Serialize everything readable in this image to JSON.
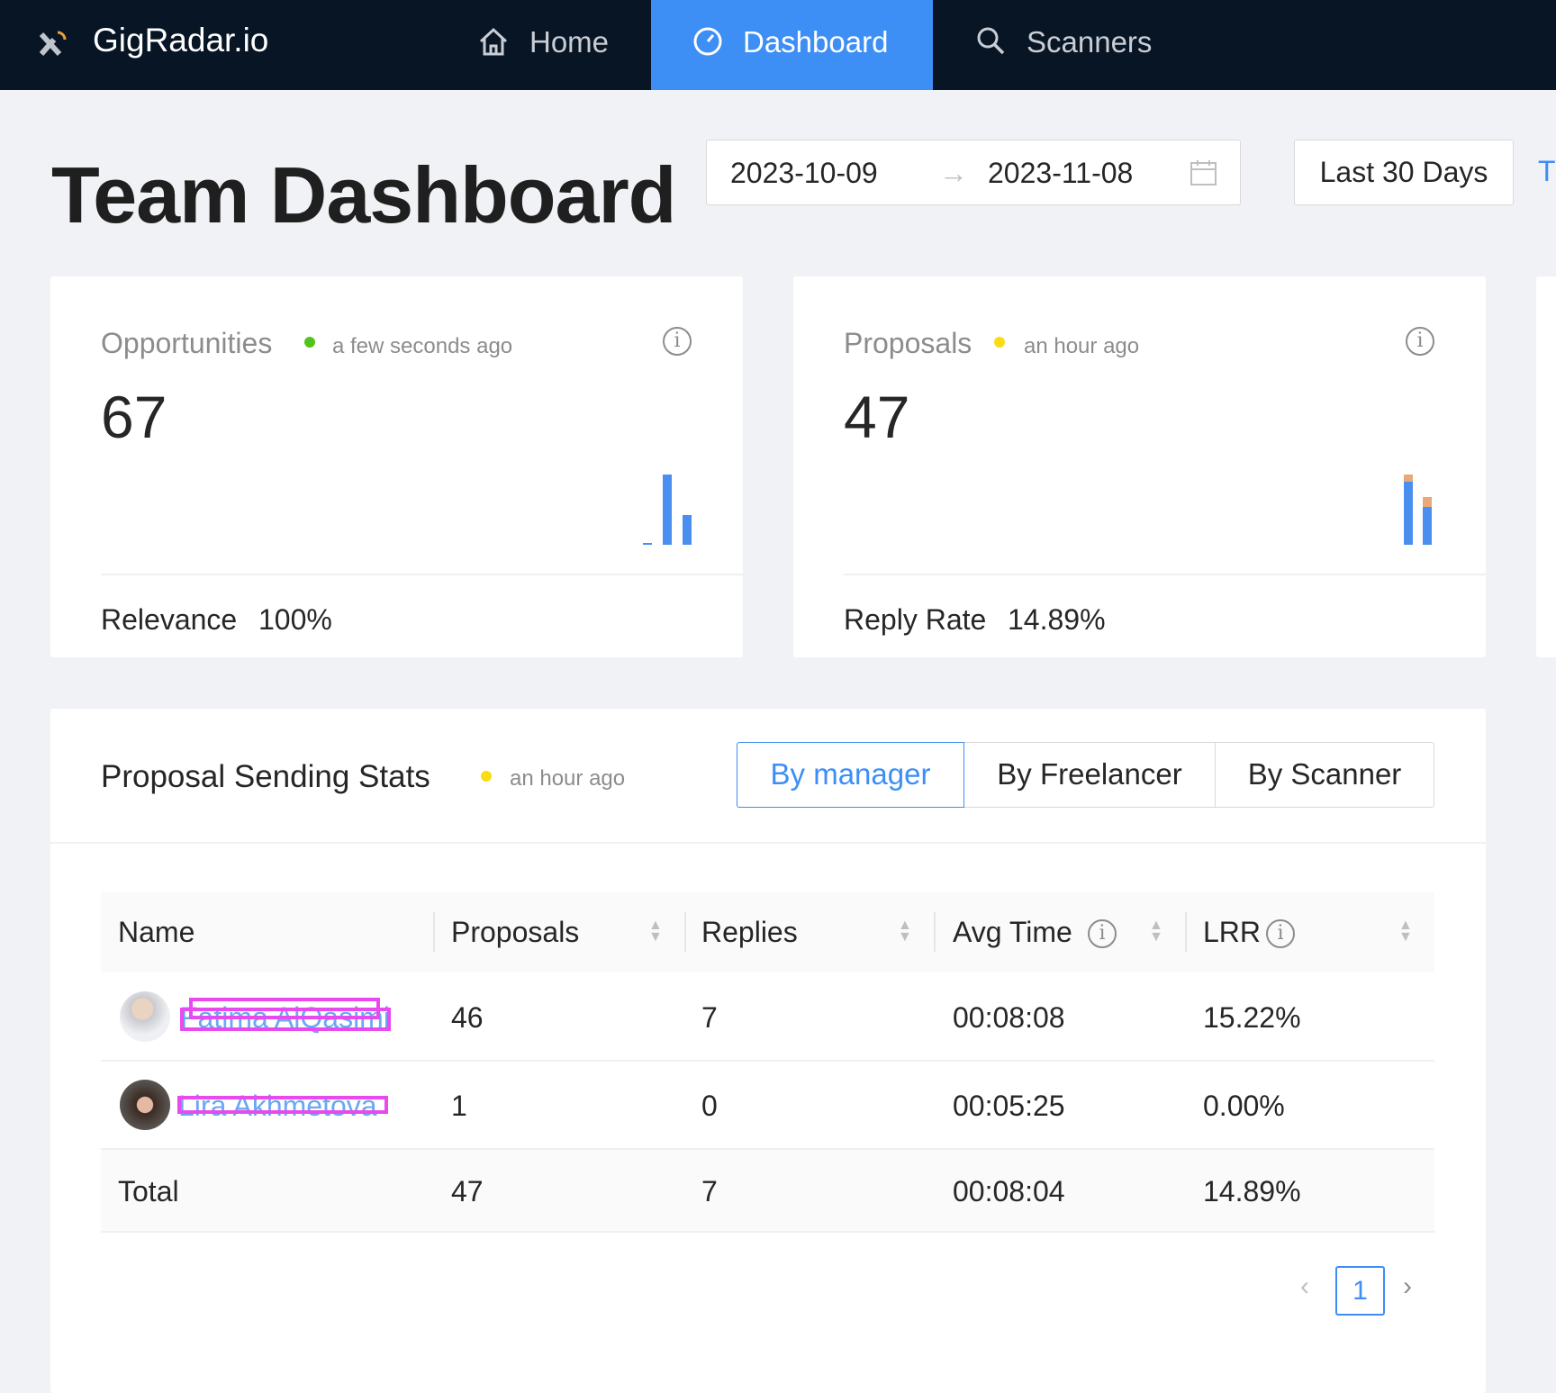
{
  "nav": {
    "brand": "GigRadar.io",
    "items": [
      {
        "label": "Home",
        "icon": "home-icon"
      },
      {
        "label": "Dashboard",
        "icon": "dashboard-icon",
        "active": true
      },
      {
        "label": "Scanners",
        "icon": "search-icon"
      }
    ],
    "active_color": "#3d8ef5"
  },
  "header": {
    "title": "Team Dashboard",
    "date_from": "2023-10-09",
    "date_to": "2023-11-08",
    "preset": "Last 30 Days",
    "cut_link": "T"
  },
  "cards": [
    {
      "label": "Opportunities",
      "status_color": "#52c41a",
      "updated": "a few seconds ago",
      "value": "67",
      "footer_label": "Relevance",
      "footer_value": "100%",
      "mini_bars": {
        "blue": [
          0,
          47,
          20
        ]
      }
    },
    {
      "label": "Proposals",
      "status_color": "#fadb14",
      "updated": "an hour ago",
      "value": "47",
      "footer_label": "Reply Rate",
      "footer_value": "14.89%",
      "mini_bars": {
        "blue": [
          25,
          15
        ],
        "orange": [
          3,
          4
        ]
      }
    }
  ],
  "stats": {
    "title": "Proposal Sending Stats",
    "status_color": "#fadb14",
    "updated": "an hour ago",
    "segments": [
      {
        "label": "By manager",
        "active": true
      },
      {
        "label": "By Freelancer"
      },
      {
        "label": "By Scanner"
      }
    ],
    "columns": [
      "Name",
      "Proposals",
      "Replies",
      "Avg Time",
      "LRR"
    ],
    "rows": [
      {
        "name": "Fatima AlQasimi",
        "proposals": "46",
        "replies": "7",
        "avg_time": "00:08:08",
        "lrr": "15.22%"
      },
      {
        "name": "Lira Akhmetova",
        "proposals": "1",
        "replies": "0",
        "avg_time": "00:05:25",
        "lrr": "0.00%"
      }
    ],
    "total": {
      "name": "Total",
      "proposals": "47",
      "replies": "7",
      "avg_time": "00:08:04",
      "lrr": "14.89%"
    },
    "pagination": {
      "current": "1"
    }
  }
}
